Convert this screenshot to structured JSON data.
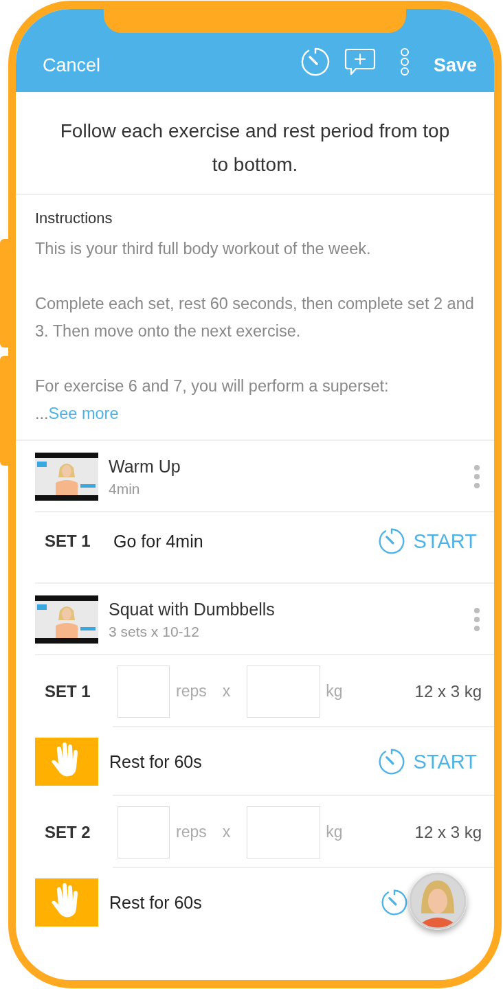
{
  "header": {
    "cancel": "Cancel",
    "save": "Save"
  },
  "intro": "Follow each exercise and rest period from top to bottom.",
  "instructions": {
    "label": "Instructions",
    "paragraphs": [
      "This is your third full body workout of the week.",
      "Complete each set, rest 60 seconds, then complete set 2 and 3. Then move onto the next exercise.",
      "For exercise 6 and 7, you will perform a superset: ..."
    ],
    "see_more": "See more"
  },
  "items": [
    {
      "kind": "exercise",
      "title": "Warm Up",
      "subtitle": "4min"
    },
    {
      "kind": "timed",
      "set": "SET 1",
      "text": "Go for 4min",
      "start": "START"
    },
    {
      "kind": "exercise",
      "title": "Squat with Dumbbells",
      "subtitle": "3 sets x 10-12"
    },
    {
      "kind": "log",
      "set": "SET 1",
      "reps": "reps",
      "times": "x",
      "unit": "kg",
      "target": "12 x 3 kg"
    },
    {
      "kind": "rest",
      "text": "Rest for 60s",
      "start": "START"
    },
    {
      "kind": "log",
      "set": "SET 2",
      "reps": "reps",
      "times": "x",
      "unit": "kg",
      "target": "12 x 3 kg"
    },
    {
      "kind": "rest",
      "text": "Rest for 60s"
    }
  ]
}
